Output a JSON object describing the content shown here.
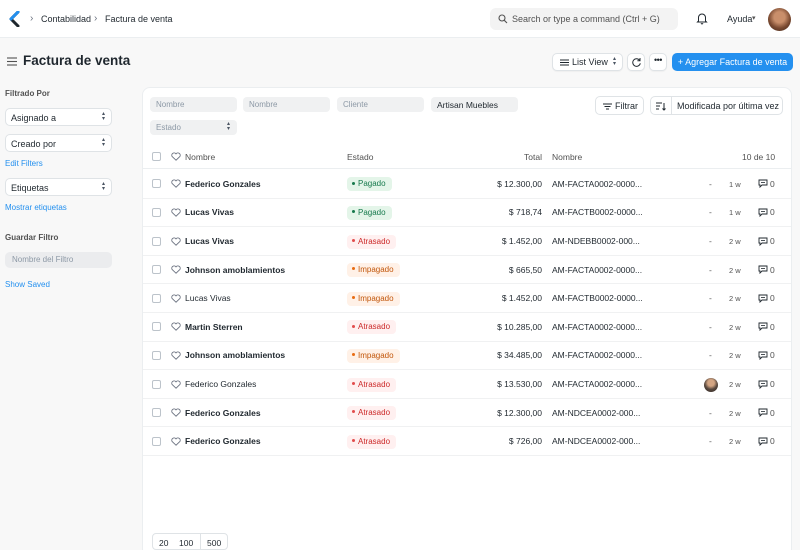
{
  "breadcrumb": {
    "items": [
      "Contabilidad",
      "Factura de venta"
    ]
  },
  "search": {
    "placeholder": "Search or type a command (Ctrl + G)"
  },
  "help": {
    "label": "Ayuda"
  },
  "page": {
    "title": "Factura de venta"
  },
  "toolbar": {
    "list_view_label": "List View",
    "add_label": "+ Agregar Factura de venta"
  },
  "sidebar": {
    "filtered_by_label": "Filtrado Por",
    "assigned_label": "Asignado a",
    "created_by_label": "Creado por",
    "edit_filters_label": "Edit Filters",
    "tags_label": "Etiquetas",
    "show_tags_label": "Mostrar etiquetas",
    "save_filter_label": "Guardar Filtro",
    "filter_name_placeholder": "Nombre del Filtro",
    "show_saved_label": "Show Saved"
  },
  "filters": {
    "placeholders": [
      "Nombre",
      "Nombre",
      "Cliente"
    ],
    "customer_value": "Artisan Muebles",
    "estado_placeholder": "Estado",
    "filter_button_label": "Filtrar",
    "sort_label": "Modificada por última vez"
  },
  "table": {
    "headers": {
      "name": "Nombre",
      "status": "Estado",
      "total": "Total",
      "id": "Nombre",
      "count": "10 de 10"
    },
    "rows": [
      {
        "name": "Federico Gonzales",
        "bold": true,
        "status": "Pagado",
        "status_color": "green",
        "total": "$ 12.300,00",
        "id": "AM-FACTA0002-0000...",
        "dash": "-",
        "age": "1 w",
        "comments": "0"
      },
      {
        "name": "Lucas Vivas",
        "bold": true,
        "status": "Pagado",
        "status_color": "green",
        "total": "$ 718,74",
        "id": "AM-FACTB0002-0000...",
        "dash": "-",
        "age": "1 w",
        "comments": "0"
      },
      {
        "name": "Lucas Vivas",
        "bold": true,
        "status": "Atrasado",
        "status_color": "red",
        "total": "$ 1.452,00",
        "id": "AM-NDEBB0002-000...",
        "dash": "-",
        "age": "2 w",
        "comments": "0"
      },
      {
        "name": "Johnson amoblamientos",
        "bold": true,
        "status": "Impagado",
        "status_color": "orange",
        "total": "$ 665,50",
        "id": "AM-FACTA0002-0000...",
        "dash": "-",
        "age": "2 w",
        "comments": "0"
      },
      {
        "name": "Lucas Vivas",
        "bold": false,
        "status": "Impagado",
        "status_color": "orange",
        "total": "$ 1.452,00",
        "id": "AM-FACTB0002-0000...",
        "dash": "-",
        "age": "2 w",
        "comments": "0"
      },
      {
        "name": "Martin Sterren",
        "bold": true,
        "status": "Atrasado",
        "status_color": "red",
        "total": "$ 10.285,00",
        "id": "AM-FACTA0002-0000...",
        "dash": "-",
        "age": "2 w",
        "comments": "0"
      },
      {
        "name": "Johnson amoblamientos",
        "bold": true,
        "status": "Impagado",
        "status_color": "orange",
        "total": "$ 34.485,00",
        "id": "AM-FACTA0002-0000...",
        "dash": "-",
        "age": "2 w",
        "comments": "0"
      },
      {
        "name": "Federico Gonzales",
        "bold": false,
        "status": "Atrasado",
        "status_color": "red",
        "total": "$ 13.530,00",
        "id": "AM-FACTA0002-0000...",
        "dash": "",
        "age": "2 w",
        "comments": "0",
        "avatar": true
      },
      {
        "name": "Federico Gonzales",
        "bold": true,
        "status": "Atrasado",
        "status_color": "red",
        "total": "$ 12.300,00",
        "id": "AM-NDCEA0002-000...",
        "dash": "-",
        "age": "2 w",
        "comments": "0"
      },
      {
        "name": "Federico Gonzales",
        "bold": true,
        "status": "Atrasado",
        "status_color": "red",
        "total": "$ 726,00",
        "id": "AM-NDCEA0002-000...",
        "dash": "-",
        "age": "2 w",
        "comments": "0"
      }
    ]
  },
  "pagination": {
    "sizes": [
      "20",
      "100",
      "500"
    ]
  },
  "icons": {
    "logo": "chevron-logo-icon",
    "search": "search-icon",
    "notifications": "bell-icon",
    "menu": "hamburger-icon",
    "list": "list-icon",
    "refresh": "refresh-icon",
    "more": "more-icon",
    "filter": "filter-icon",
    "sort": "sort-icon",
    "favorite": "heart-icon",
    "comment": "comment-icon"
  },
  "colors": {
    "primary": "#2490ef",
    "paid": "#16794c",
    "overdue": "#cc2929",
    "unpaid": "#c2560a"
  }
}
